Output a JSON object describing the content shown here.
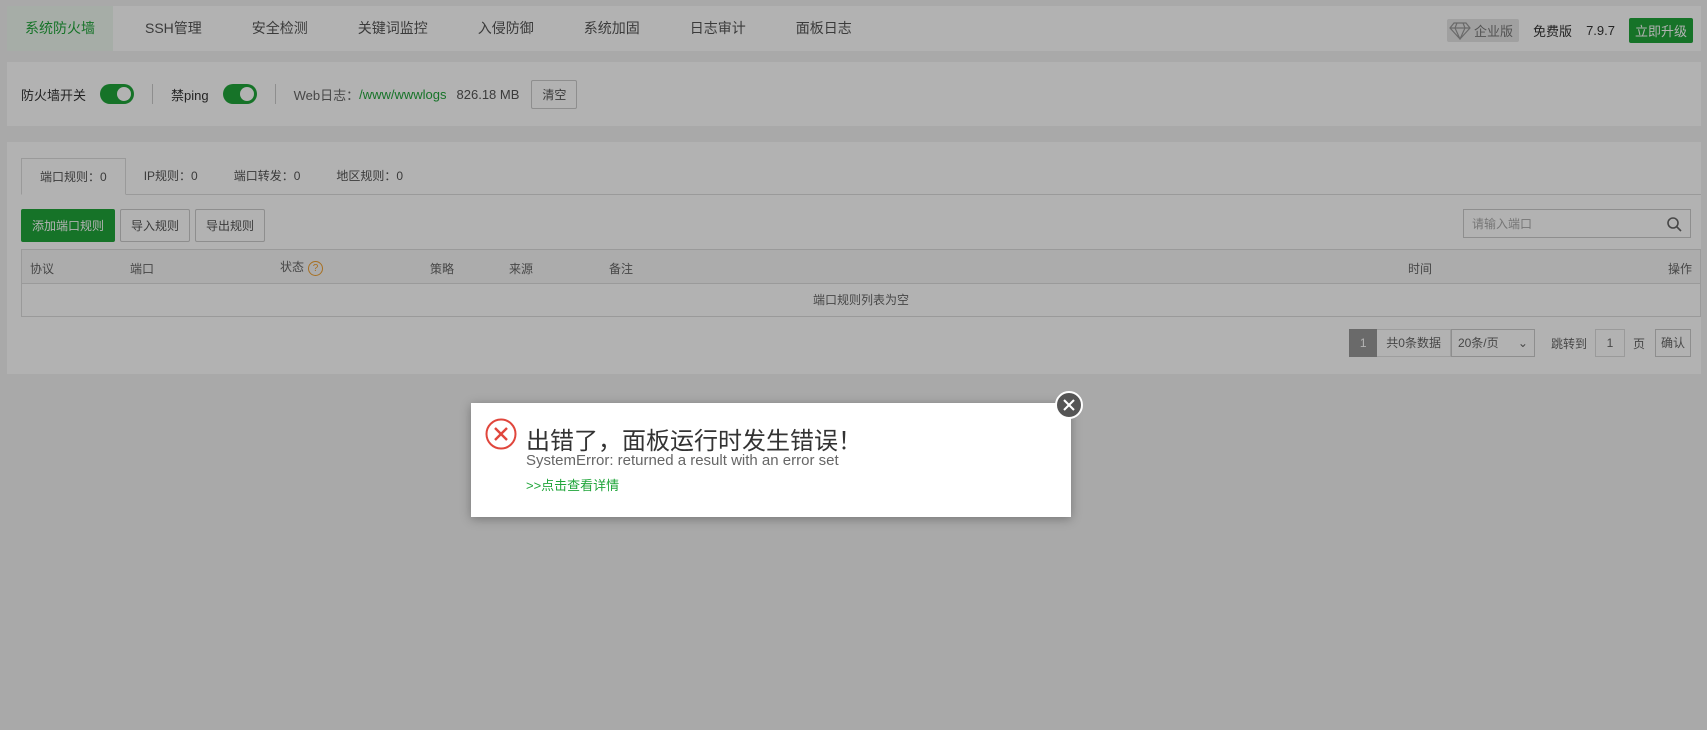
{
  "nav": {
    "tabs": [
      "系统防火墙",
      "SSH管理",
      "安全检测",
      "关键词监控",
      "入侵防御",
      "系统加固",
      "日志审计",
      "面板日志"
    ],
    "right": {
      "enterprise": "企业版",
      "free": "免费版",
      "version": "7.9.7",
      "upgrade": "立即升级"
    }
  },
  "toolbar": {
    "firewall_label": "防火墙开关",
    "ping_label": "禁ping",
    "weblog_label": "Web日志：",
    "weblog_path": "/www/wwwlogs",
    "weblog_size": "826.18 MB",
    "clear": "清空"
  },
  "panel": {
    "tabs": [
      "端口规则：0",
      "IP规则：0",
      "端口转发：0",
      "地区规则：0"
    ],
    "add_btn": "添加端口规则",
    "import_btn": "导入规则",
    "export_btn": "导出规则",
    "search_placeholder": "请输入端口",
    "columns": {
      "protocol": "协议",
      "port": "端口",
      "status": "状态",
      "strategy": "策略",
      "source": "来源",
      "remark": "备注",
      "time": "时间",
      "ops": "操作"
    },
    "empty": "端口规则列表为空",
    "pager": {
      "current": "1",
      "total": "共0条数据",
      "per_page": "20条/页",
      "jump": "跳转到",
      "page_input": "1",
      "page_unit": "页",
      "confirm": "确认"
    }
  },
  "dialog": {
    "title": "出错了，面板运行时发生错误！",
    "message": "SystemError: returned a result with an error set",
    "link": ">>点击查看详情"
  },
  "colors": {
    "accent": "#20a53a",
    "error": "#e0463c"
  }
}
